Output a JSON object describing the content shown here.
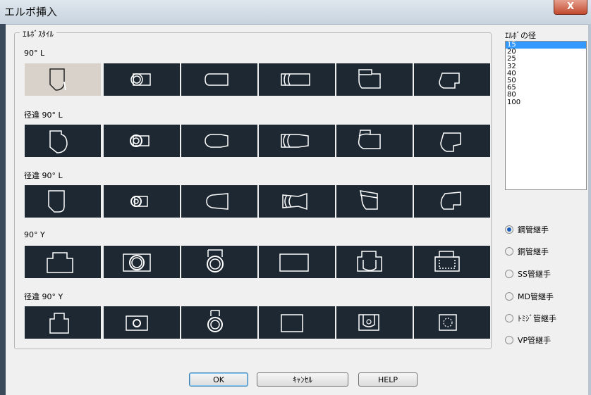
{
  "window": {
    "title": "エルボ挿入",
    "close_label": "X"
  },
  "style_group": {
    "label": "ｴﾙﾎﾞｽﾀｲﾙ",
    "rows": [
      {
        "label": "90° L"
      },
      {
        "label": "径違 90° L"
      },
      {
        "label": "径違 90° L"
      },
      {
        "label": "90° Y"
      },
      {
        "label": "径違 90° Y"
      }
    ],
    "selected": {
      "row": 0,
      "col": 0
    }
  },
  "diameter": {
    "label": "ｴﾙﾎﾞの径",
    "items": [
      "15",
      "20",
      "25",
      "32",
      "40",
      "50",
      "65",
      "80",
      "100"
    ],
    "selected_index": 0
  },
  "joint_types": {
    "options": [
      "鋼管継手",
      "銅管継手",
      "SS管継手",
      "MD管継手",
      "ﾄﾐｼﾞ管継手",
      "VP管継手"
    ],
    "selected_index": 0
  },
  "buttons": {
    "ok": "OK",
    "cancel": "ｷｬﾝｾﾙ",
    "help": "HELP"
  },
  "colors": {
    "tile_bg": "#1d2833",
    "selected_tile_bg": "#d8d2ca",
    "list_highlight": "#3399ff"
  }
}
